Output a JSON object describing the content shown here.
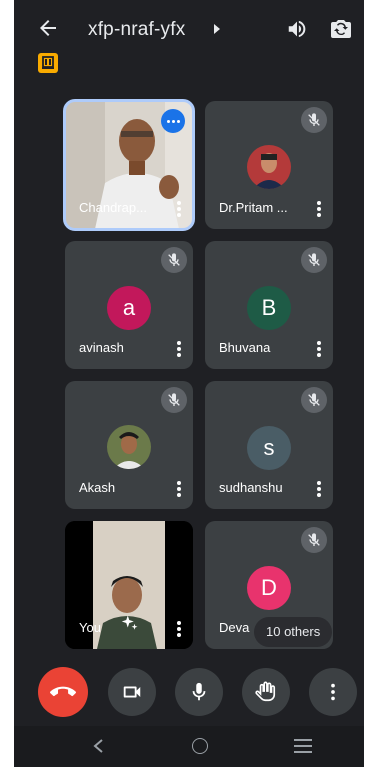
{
  "header": {
    "meeting_code": "xfp-nraf-yfx"
  },
  "participants": [
    {
      "name": "Chandrap...",
      "type": "video",
      "speaking": true
    },
    {
      "name": "Dr.Pritam ...",
      "type": "photo",
      "muted": true
    },
    {
      "name": "avinash",
      "type": "initial",
      "initial": "a",
      "color": "#c2185b",
      "muted": true
    },
    {
      "name": "Bhuvana",
      "type": "initial",
      "initial": "B",
      "color": "#1e5b46",
      "muted": true
    },
    {
      "name": "Akash",
      "type": "photo",
      "muted": true
    },
    {
      "name": "sudhanshu",
      "type": "initial",
      "initial": "s",
      "color": "#4a5d66",
      "muted": true
    },
    {
      "name": "You",
      "type": "video-self"
    },
    {
      "name": "Deva",
      "type": "initial",
      "initial": "D",
      "color": "#e8336d",
      "muted": true
    }
  ],
  "others_label": "10 others",
  "controls": [
    "end-call",
    "camera",
    "microphone",
    "raise-hand",
    "more-options"
  ],
  "colors": {
    "background": "#1f2024",
    "tile": "#3c4043",
    "end_call": "#ea4335",
    "active_outline": "#aecbfa"
  }
}
